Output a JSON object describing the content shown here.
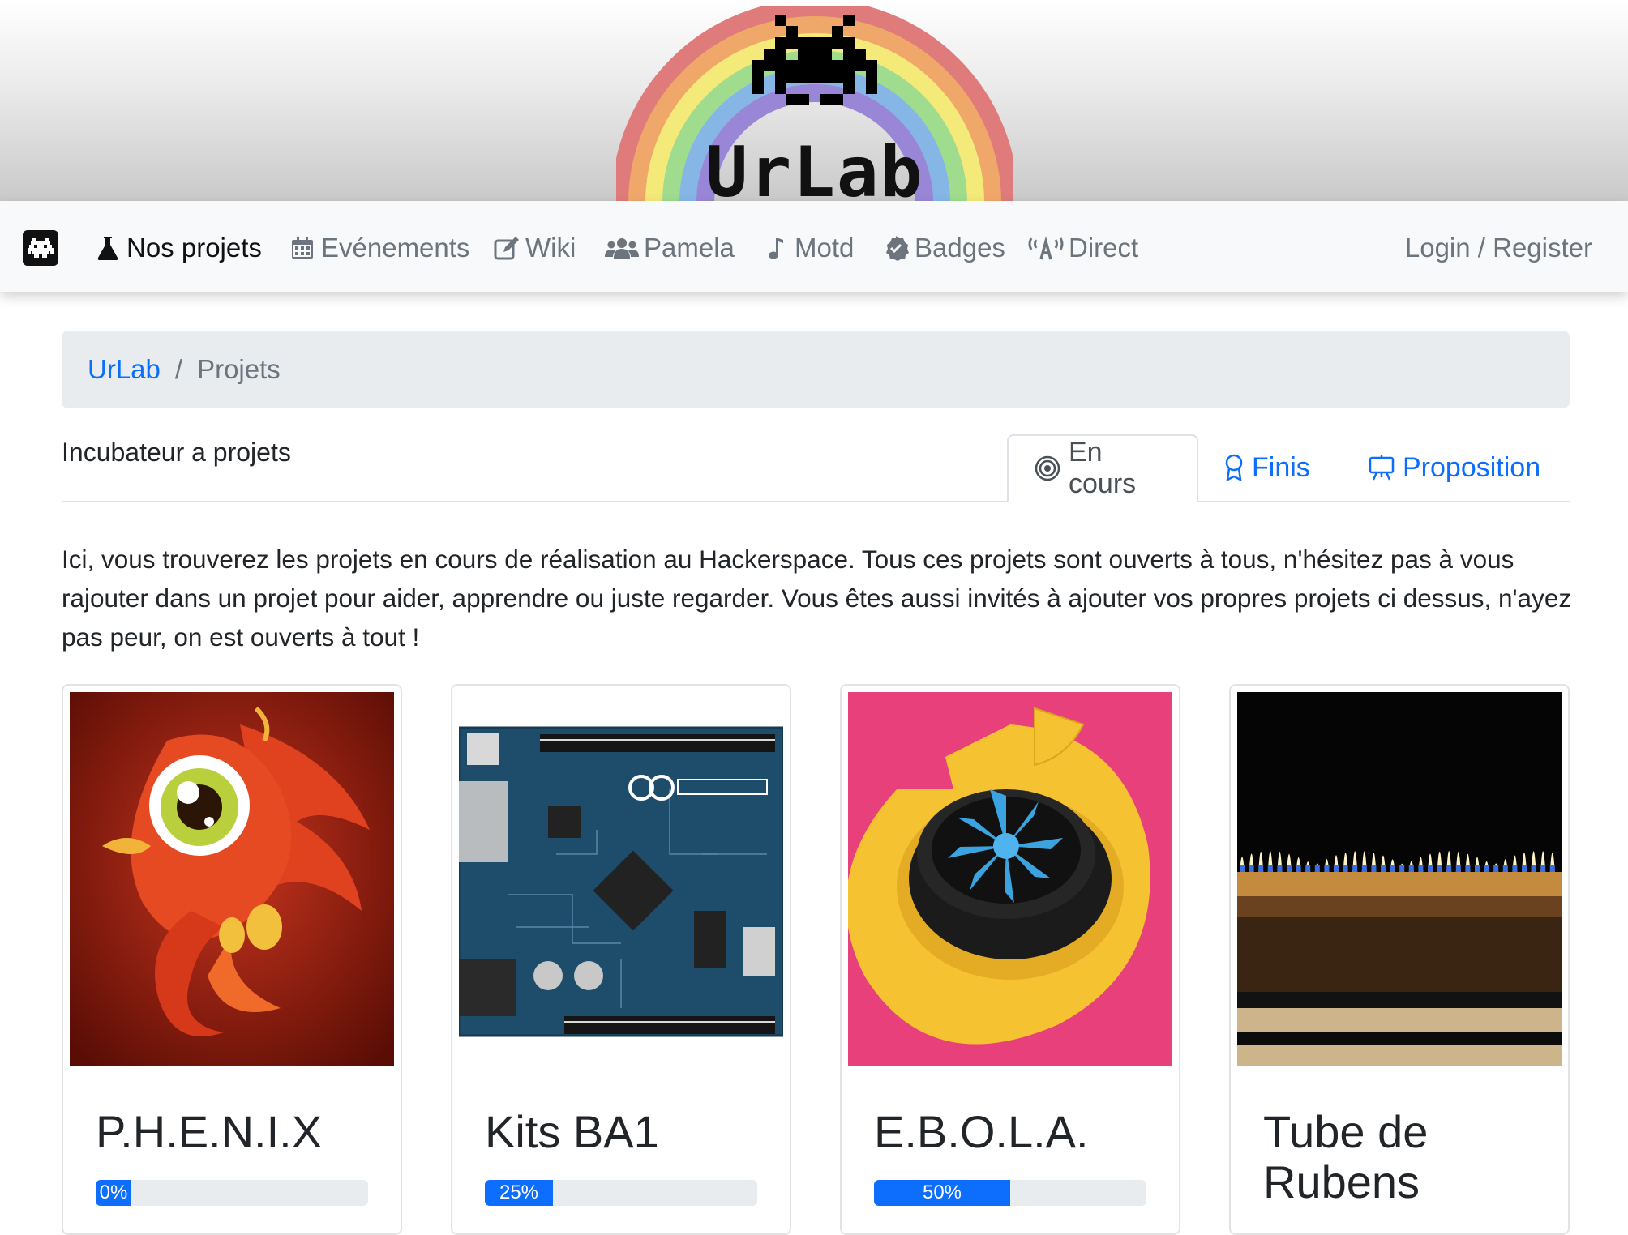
{
  "logo": {
    "text": "UrLab"
  },
  "nav": {
    "items": [
      {
        "label": "Nos projets",
        "icon": "flask-icon",
        "active": true
      },
      {
        "label": "Evénements",
        "icon": "calendar-icon"
      },
      {
        "label": "Wiki",
        "icon": "edit-icon"
      },
      {
        "label": "Pamela",
        "icon": "users-icon"
      },
      {
        "label": "Motd",
        "icon": "music-note-icon"
      },
      {
        "label": "Badges",
        "icon": "badge-check-icon"
      },
      {
        "label": "Direct",
        "icon": "broadcast-icon"
      }
    ],
    "login": "Login / Register"
  },
  "breadcrumb": {
    "home": "UrLab",
    "separator": "/",
    "current": "Projets"
  },
  "section": {
    "title": "Incubateur a projets",
    "tabs": [
      {
        "label": "En cours",
        "icon": "target-icon",
        "active": true
      },
      {
        "label": "Finis",
        "icon": "award-icon"
      },
      {
        "label": "Proposition",
        "icon": "easel-icon"
      }
    ]
  },
  "intro": "Ici, vous trouverez les projets en cours de réalisation au Hackerspace. Tous ces projets sont ouverts à tous, n'hésitez pas à vous rajouter dans un projet pour aider, apprendre ou juste regarder. Vous êtes aussi invités à ajouter vos propres projets ci dessus, n'ayez pas peur, on est ouverts à tout !",
  "projects": [
    {
      "title": "P.H.E.N.I.X",
      "progress_label": "0%",
      "progress": 0,
      "image": "phoenix-illustration"
    },
    {
      "title": "Kits BA1",
      "progress_label": "25%",
      "progress": 25,
      "image": "arduino-board-photo"
    },
    {
      "title": "E.B.O.L.A.",
      "progress_label": "50%",
      "progress": 50,
      "image": "3d-printed-turbine-photo"
    },
    {
      "title": "Tube de Rubens",
      "progress_label": null,
      "progress": null,
      "image": "rubens-tube-flames-photo"
    }
  ],
  "colors": {
    "link": "#0d6efd",
    "progress": "#0d6efd",
    "breadcrumb_bg": "#e9ecef",
    "navbar_bg": "#f8f9fa"
  }
}
